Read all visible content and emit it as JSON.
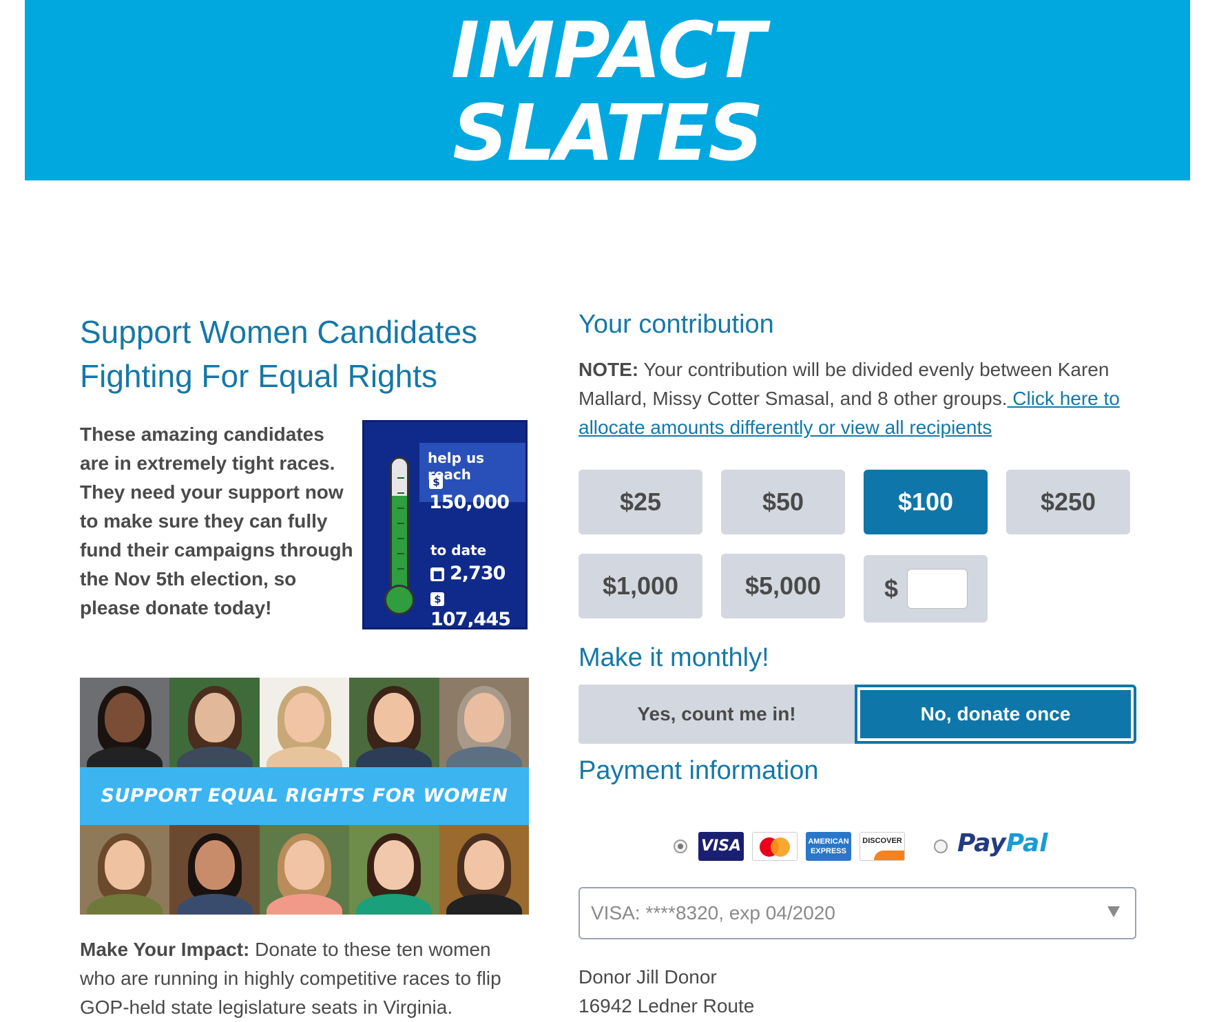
{
  "banner": {
    "line1": "IMPACT",
    "line2": "SLATES",
    "bg_color": "#00a8e0"
  },
  "left": {
    "heading": "Support Women Candidates Fighting For Equal Rights",
    "intro": "These amazing candidates are in extremely tight races. They need your support now to make sure they can fully fund their campaigns through the Nov 5th election, so please donate today!",
    "thermometer": {
      "help_label": "help us reach",
      "goal": "150,000",
      "to_date_label": "to date",
      "donors": "2,730",
      "raised": "107,445",
      "progress_fraction": 0.72
    },
    "photo_banner": "SUPPORT EQUAL RIGHTS FOR WOMEN",
    "impact_bold": "Make Your Impact:",
    "impact_text": " Donate to these ten women who are running in highly competitive races to flip GOP-held state legislature seats in Virginia."
  },
  "right": {
    "contribution_title": "Your contribution",
    "note_bold": "NOTE:",
    "note_text": " Your contribution will be divided evenly between Karen Mallard, Missy Cotter Smasal, and 8 other groups.",
    "note_link": " Click here to allocate amounts differently or view all recipients",
    "amounts": [
      "$25",
      "$50",
      "$100",
      "$250",
      "$1,000",
      "$5,000"
    ],
    "selected_amount": "$100",
    "custom_symbol": "$",
    "custom_value": "",
    "monthly_title": "Make it monthly!",
    "monthly_yes": "Yes, count me in!",
    "monthly_no": "No, donate once",
    "payment_title": "Payment information",
    "card_brands": [
      "VISA",
      "Mastercard",
      "AMERICAN EXPRESS",
      "DISCOVER"
    ],
    "amex_label": "AMERICAN EXPRESS",
    "discover_label": "DISCOVER",
    "paypal_pay": "Pay",
    "paypal_pal": "Pal",
    "saved_card": "VISA: ****8320, exp 04/2020",
    "donor_name": "Donor Jill Donor",
    "donor_address": "16942 Ledner Route",
    "accent_color": "#0e76a8"
  }
}
